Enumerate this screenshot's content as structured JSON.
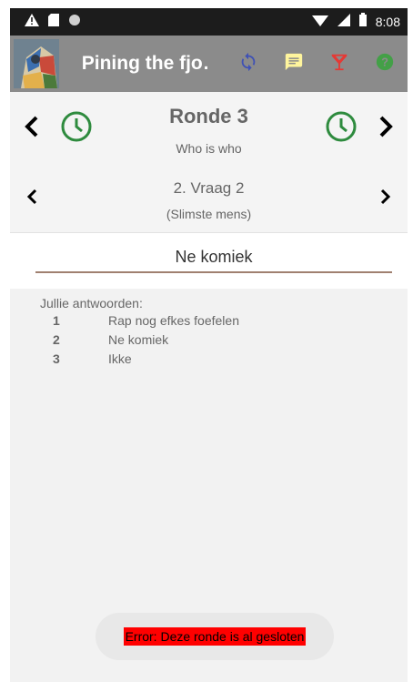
{
  "status_bar": {
    "time": "8:08",
    "icons": [
      "warning-icon",
      "sd-card-icon",
      "circle-icon",
      "wifi-icon",
      "signal-icon",
      "battery-icon"
    ]
  },
  "toolbar": {
    "title": "Pining the fjo…",
    "actions": [
      "sync-icon",
      "message-icon",
      "cocktail-icon",
      "help-icon"
    ]
  },
  "round": {
    "title": "Ronde 3",
    "subtitle": "Who is who"
  },
  "question": {
    "title": "2. Vraag 2",
    "subtitle": "(Slimste mens)"
  },
  "answer_field": {
    "value": "Ne komiek"
  },
  "answers": {
    "label": "Jullie antwoorden:",
    "items": [
      {
        "number": "1",
        "text": "Rap nog efkes foefelen"
      },
      {
        "number": "2",
        "text": "Ne komiek"
      },
      {
        "number": "3",
        "text": "Ikke"
      }
    ]
  },
  "toast": {
    "message": "Error: Deze ronde is al gesloten"
  },
  "colors": {
    "toolbar": "#8b8b8b",
    "clock_green": "#2e8b3e",
    "sync_blue": "#3f51b5",
    "message_yellow": "#fff59d",
    "cocktail_red": "#e53935",
    "help_green": "#43a047",
    "toast_highlight": "#ff0000"
  }
}
